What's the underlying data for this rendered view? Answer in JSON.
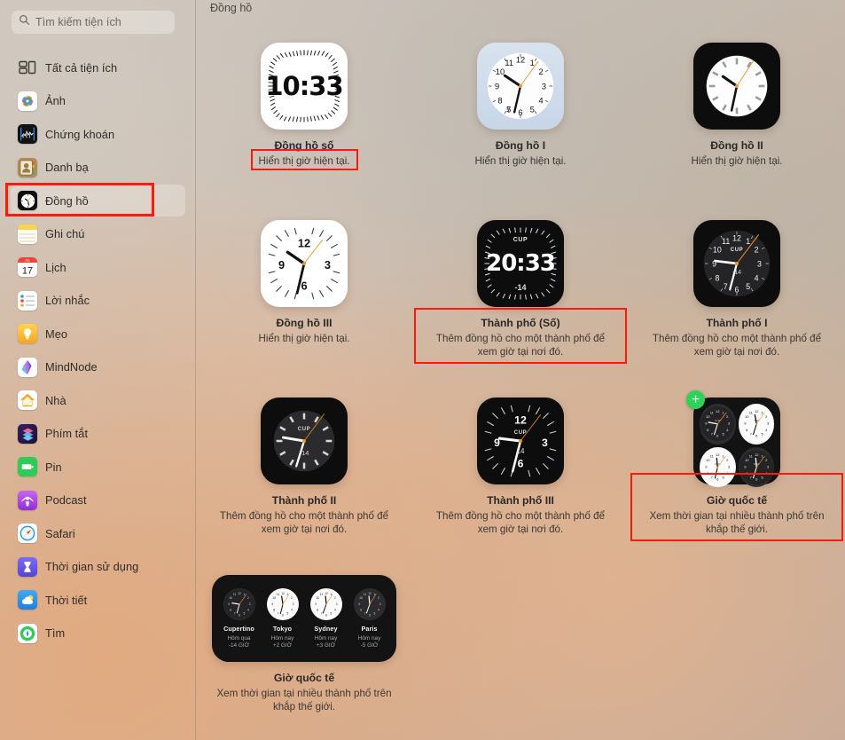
{
  "sidebar": {
    "search": {
      "placeholder": "Tìm kiếm tiện ích",
      "value": "",
      "icon": "search-icon"
    },
    "items": [
      {
        "label": "Tất cả tiện ích",
        "icon": "all-widgets-icon",
        "selected": false
      },
      {
        "label": "Ảnh",
        "icon": "photos-app-icon",
        "selected": false
      },
      {
        "label": "Chứng khoán",
        "icon": "stocks-app-icon",
        "selected": false
      },
      {
        "label": "Danh bạ",
        "icon": "contacts-app-icon",
        "selected": false
      },
      {
        "label": "Đồng hồ",
        "icon": "clock-app-icon",
        "selected": true
      },
      {
        "label": "Ghi chú",
        "icon": "notes-app-icon",
        "selected": false
      },
      {
        "label": "Lịch",
        "icon": "calendar-app-icon",
        "selected": false
      },
      {
        "label": "Lời nhắc",
        "icon": "reminders-app-icon",
        "selected": false
      },
      {
        "label": "Mẹo",
        "icon": "tips-app-icon",
        "selected": false
      },
      {
        "label": "MindNode",
        "icon": "mindnode-app-icon",
        "selected": false
      },
      {
        "label": "Nhà",
        "icon": "home-app-icon",
        "selected": false
      },
      {
        "label": "Phím tắt",
        "icon": "shortcuts-app-icon",
        "selected": false
      },
      {
        "label": "Pin",
        "icon": "battery-app-icon",
        "selected": false
      },
      {
        "label": "Podcast",
        "icon": "podcasts-app-icon",
        "selected": false
      },
      {
        "label": "Safari",
        "icon": "safari-app-icon",
        "selected": false
      },
      {
        "label": "Thời gian sử dụng",
        "icon": "screen-time-app-icon",
        "selected": false
      },
      {
        "label": "Thời tiết",
        "icon": "weather-app-icon",
        "selected": false
      },
      {
        "label": "Tìm",
        "icon": "find-my-app-icon",
        "selected": false
      }
    ]
  },
  "main": {
    "panel_title": "Đồng hồ",
    "widgets": [
      {
        "title": "Đồng hồ số",
        "desc": "Hiển thị giờ hiện tại.",
        "kind": "digital-light",
        "time": "10:33",
        "highlight": true
      },
      {
        "title": "Đồng hồ I",
        "desc": "Hiển thị giờ hiện tại.",
        "kind": "analog-numerals-light",
        "highlight": false
      },
      {
        "title": "Đồng hồ II",
        "desc": "Hiển thị giờ hiện tại.",
        "kind": "analog-ticks-dark",
        "highlight": false
      },
      {
        "title": "Đồng hồ III",
        "desc": "Hiển thị giờ hiện tại.",
        "kind": "analog-quarter-light",
        "highlight": false
      },
      {
        "title": "Thành phố (Số)",
        "desc": "Thêm đồng hồ cho một thành phố để xem giờ tại nơi đó.",
        "kind": "digital-city-dark",
        "city_code": "CUP",
        "time": "20:33",
        "offset": "-14",
        "highlight": true
      },
      {
        "title": "Thành phố I",
        "desc": "Thêm đồng hồ cho một thành phố để xem giờ tại nơi đó.",
        "kind": "analog-city-numerals-dark",
        "city_code": "CUP",
        "offset": "-14",
        "highlight": false
      },
      {
        "title": "Thành phố II",
        "desc": "Thêm đồng hồ cho một thành phố để xem giờ tại nơi đó.",
        "kind": "analog-city-ticks-dark",
        "city_code": "CUP",
        "offset": "-14",
        "highlight": false
      },
      {
        "title": "Thành phố III",
        "desc": "Thêm đồng hồ cho một thành phố để xem giờ tại nơi đó.",
        "kind": "analog-city-quarter-dark",
        "city_code": "CUP",
        "offset": "14",
        "highlight": false
      },
      {
        "title": "Giờ quốc tế",
        "desc": "Xem thời gian tại nhiều thành phố trên khắp thế giới.",
        "kind": "world-clock-quad",
        "badge": "+",
        "badge_color": "#30d158",
        "quad_codes": [
          "CUP",
          "TOK",
          "SYD",
          "PAR"
        ],
        "highlight": true
      },
      {
        "title": "Giờ quốc tế",
        "desc": "Xem thời gian tại nhiều thành phố trên khắp thế giới.",
        "kind": "world-clock-wide",
        "highlight": false,
        "cities": [
          {
            "name": "Cupertino",
            "day": "Hôm qua",
            "offset": "-14 GIỜ",
            "theme": "dark"
          },
          {
            "name": "Tokyo",
            "day": "Hôm nay",
            "offset": "+2 GIỜ",
            "theme": "light"
          },
          {
            "name": "Sydney",
            "day": "Hôm nay",
            "offset": "+3 GIỜ",
            "theme": "light"
          },
          {
            "name": "Paris",
            "day": "Hôm nay",
            "offset": "-5 GIỜ",
            "theme": "dark"
          }
        ]
      }
    ]
  },
  "annotation": {
    "color": "#fb1a0c",
    "style": "red-rectangle-highlight"
  }
}
